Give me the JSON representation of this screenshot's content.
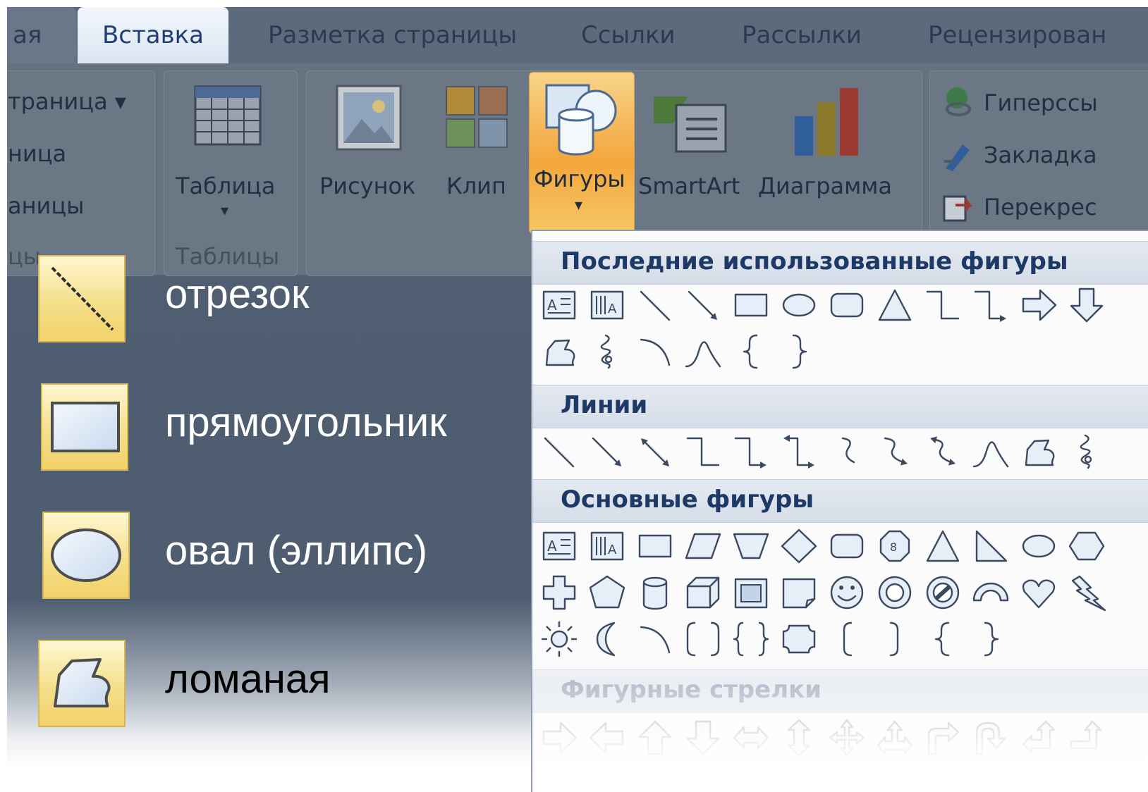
{
  "tabs": [
    {
      "label": "ая",
      "active": false
    },
    {
      "label": "Вставка",
      "active": true
    },
    {
      "label": "Разметка страницы",
      "active": false
    },
    {
      "label": "Ссылки",
      "active": false
    },
    {
      "label": "Рассылки",
      "active": false
    },
    {
      "label": "Рецензирован",
      "active": false
    }
  ],
  "ribbon": {
    "pages_group": {
      "items": [
        "траница ▾",
        "ница",
        "аницы"
      ],
      "group_label": "цы"
    },
    "tables_group": {
      "table_label": "Таблица",
      "group_label": "Таблицы"
    },
    "illustrations": {
      "picture_label": "Рисунок",
      "clip_label": "Клип",
      "shapes_label": "Фигуры",
      "smartart_label": "SmartArt",
      "chart_label": "Диаграмма"
    },
    "links_group": {
      "hyperlink": "Гиперссы",
      "bookmark": "Закладка",
      "crossref": "Перекрес"
    },
    "colors": {
      "accent": "#f3a63c",
      "dim": "#66727f"
    }
  },
  "gallery": {
    "recent_title": "Последние использованные фигуры",
    "recent_row1": [
      "text-box-icon",
      "vertical-text-box-icon",
      "line-icon",
      "arrow-line-icon",
      "rectangle-icon",
      "oval-icon",
      "rounded-rectangle-icon",
      "triangle-icon",
      "elbow-connector-icon",
      "elbow-arrow-connector-icon",
      "right-arrow-icon",
      "down-arrow-icon"
    ],
    "recent_row2": [
      "freeform-icon",
      "scribble-icon",
      "arc-icon",
      "curve-icon",
      "left-brace-icon",
      "right-brace-icon"
    ],
    "lines_title": "Линии",
    "lines_row": [
      "line-icon",
      "arrow-line-icon",
      "double-arrow-line-icon",
      "elbow-connector-icon",
      "elbow-arrow-connector-icon",
      "elbow-double-arrow-connector-icon",
      "curved-connector-icon",
      "curved-arrow-connector-icon",
      "curved-double-arrow-connector-icon",
      "curve-icon",
      "freeform-icon",
      "scribble-icon"
    ],
    "basic_title": "Основные фигуры",
    "basic_row1": [
      "text-box-icon",
      "vertical-text-box-icon",
      "rectangle-icon",
      "parallelogram-icon",
      "trapezoid-icon",
      "diamond-icon",
      "rounded-rectangle-icon",
      "octagon-icon",
      "triangle-icon",
      "right-triangle-icon",
      "oval-icon",
      "hexagon-icon"
    ],
    "basic_row2": [
      "cross-icon",
      "pentagon-icon",
      "can-icon",
      "cube-icon",
      "bevel-icon",
      "folded-corner-icon",
      "smiley-icon",
      "donut-icon",
      "no-symbol-icon",
      "block-arc-icon",
      "heart-icon",
      "lightning-icon"
    ],
    "basic_row3": [
      "sun-icon",
      "moon-icon",
      "arc-icon",
      "double-bracket-icon",
      "double-brace-icon",
      "plaque-icon",
      "left-bracket-icon",
      "right-bracket-icon",
      "left-brace-icon",
      "right-brace-icon"
    ],
    "block_arrows_title": "Фигурные стрелки",
    "block_arrows_row": [
      "right-arrow-icon",
      "left-arrow-icon",
      "up-arrow-icon",
      "down-arrow-icon",
      "left-right-arrow-icon",
      "up-down-arrow-icon",
      "quad-arrow-icon",
      "left-right-up-arrow-icon",
      "bent-arrow-icon",
      "u-turn-arrow-icon",
      "left-up-arrow-icon",
      "bent-up-arrow-icon"
    ]
  },
  "legend": [
    {
      "label": "отрезок",
      "icon": "line-icon"
    },
    {
      "label": "прямоугольник",
      "icon": "rectangle-icon"
    },
    {
      "label": "овал (эллипс)",
      "icon": "oval-icon"
    },
    {
      "label": "ломаная",
      "icon": "freeform-icon"
    }
  ]
}
